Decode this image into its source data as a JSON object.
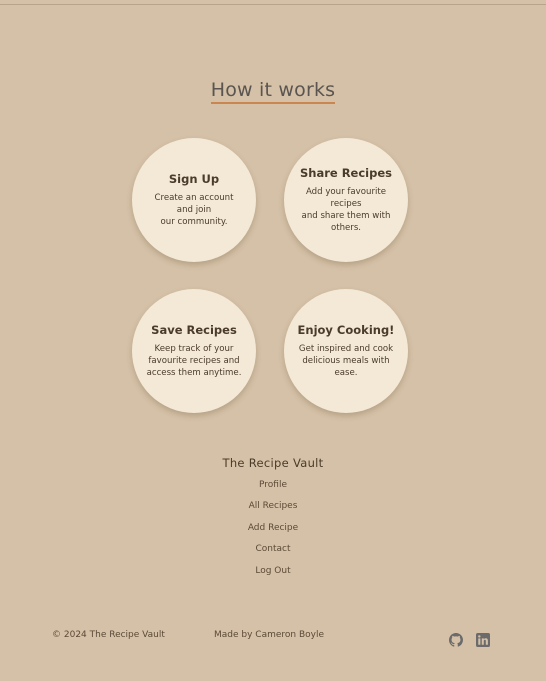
{
  "section": {
    "title": "How it works"
  },
  "steps": [
    {
      "title": "Sign Up",
      "text": "Create an account\nand join\nour community."
    },
    {
      "title": "Share Recipes",
      "text": "Add your favourite\nrecipes\nand share them with\nothers."
    },
    {
      "title": "Save Recipes",
      "text": "Keep track of your\nfavourite recipes and\naccess them anytime."
    },
    {
      "title": "Enjoy Cooking!",
      "text": "Get inspired and cook\ndelicious meals with\nease."
    }
  ],
  "footer": {
    "brand": "The Recipe Vault",
    "links": [
      "Profile",
      "All Recipes",
      "Add Recipe",
      "Contact",
      "Log Out"
    ],
    "copyright": "© 2024 The Recipe Vault",
    "credit": "Made by Cameron Boyle",
    "social": [
      "github-icon",
      "linkedin-icon"
    ]
  },
  "colors": {
    "background": "#d5c1a7",
    "circle": "#f3e9d6",
    "accent_underline": "#c9874f",
    "text": "#4b3b2a"
  }
}
